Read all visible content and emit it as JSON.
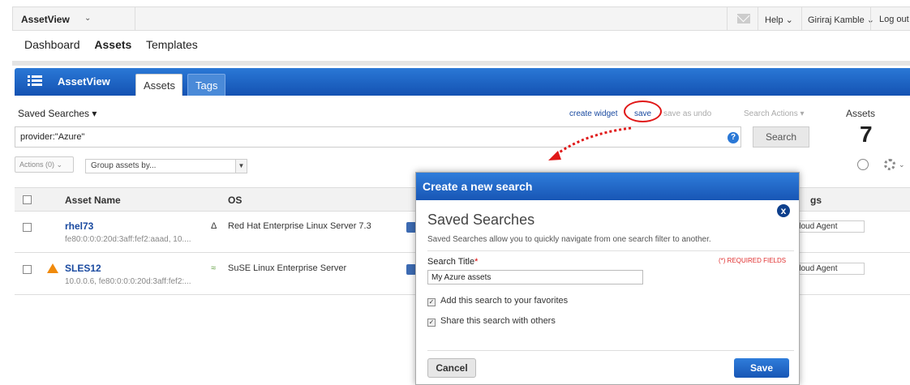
{
  "topbar": {
    "app_name": "AssetView",
    "help": "Help",
    "user": "Giriraj Kamble",
    "logout": "Log out"
  },
  "nav": {
    "items": [
      "Dashboard",
      "Assets",
      "Templates"
    ],
    "active": "Assets"
  },
  "module": {
    "title": "AssetView",
    "tabs": [
      "Assets",
      "Tags"
    ],
    "active_tab": "Assets"
  },
  "toolbar": {
    "saved_searches": "Saved Searches",
    "create_widget": "create widget",
    "save": "save",
    "save_as": "save as",
    "undo": "undo",
    "search_actions": "Search Actions",
    "assets_label": "Assets",
    "assets_count": "7"
  },
  "search": {
    "query": "provider:\"Azure\"",
    "button": "Search",
    "help_glyph": "?"
  },
  "actions": {
    "actions_label": "Actions (0)",
    "group_placeholder": "Group assets by..."
  },
  "table": {
    "columns": [
      "Asset Name",
      "OS",
      "gs"
    ],
    "rows": [
      {
        "name": "rhel73",
        "ip": "fe80:0:0:0:20d:3aff:fef2:aaad, 10....",
        "os": "Red Hat Enterprise Linux Server 7.3",
        "tag": "Cloud Agent",
        "warning": false
      },
      {
        "name": "SLES12",
        "ip": "10.0.0.6, fe80:0:0:0:20d:3aff:fef2:...",
        "os": "SuSE Linux Enterprise Server",
        "tag": "Cloud Agent",
        "warning": true
      }
    ]
  },
  "modal": {
    "header": "Create a new search",
    "close": "x",
    "title": "Saved Searches",
    "description": "Saved Searches allow you to quickly navigate from one search filter to another.",
    "field_label": "Search Title",
    "required_mark": "*",
    "required_note": "(*) REQUIRED FIELDS",
    "field_value": "My Azure assets",
    "options": [
      {
        "label": "Add this search to your favorites",
        "checked": true
      },
      {
        "label": "Share this search with others",
        "checked": true
      }
    ],
    "cancel": "Cancel",
    "save": "Save"
  },
  "colors": {
    "brand_blue": "#1452b2",
    "highlight_red": "#e01818",
    "warning": "#f08a0c"
  }
}
